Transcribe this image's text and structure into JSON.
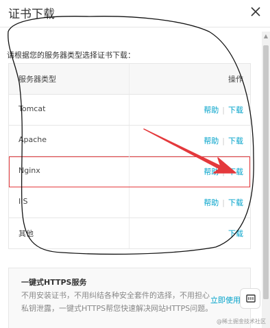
{
  "dialog": {
    "title": "证书下载",
    "close_icon": "close-icon"
  },
  "intro": "请根据您的服务器类型选择证书下载：",
  "table": {
    "headers": [
      "服务器类型",
      "操作"
    ],
    "rows": [
      {
        "type": "Tomcat",
        "help": "帮助",
        "download": "下载",
        "sep": "|"
      },
      {
        "type": "Apache",
        "help": "帮助",
        "download": "下载",
        "sep": "|"
      },
      {
        "type": "Nginx",
        "help": "帮助",
        "download": "下载",
        "sep": "|"
      },
      {
        "type": "IIS",
        "help": "帮助",
        "download": "下载",
        "sep": "|"
      },
      {
        "type": "其他",
        "download": "下载"
      }
    ]
  },
  "promo": {
    "title": "一键式HTTPS服务",
    "desc": "不用安装证书，不用纠结各种安全套件的选择，不用担心私钥泄露，一键式HTTPS帮您快速解决网站HTTPS问题。",
    "button": "立即使用"
  },
  "watermark": "@稀土掘金技术社区",
  "colors": {
    "accent": "#00a2ca",
    "highlight_border": "#e4393c",
    "annotation_arrow": "#e4393c"
  }
}
